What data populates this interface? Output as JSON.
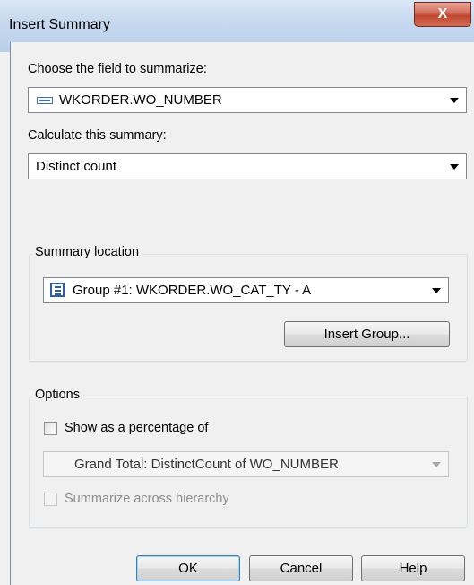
{
  "window": {
    "title": "Insert Summary",
    "close_label": "X"
  },
  "field": {
    "label": "Choose the field to summarize:",
    "value": "WKORDER.WO_NUMBER",
    "icon": "field-icon"
  },
  "summary": {
    "label": "Calculate this summary:",
    "value": "Distinct count"
  },
  "location": {
    "group_label": "Summary location",
    "value": "Group #1: WKORDER.WO_CAT_TY - A",
    "icon": "group-icon",
    "insert_group_label": "Insert Group..."
  },
  "options": {
    "group_label": "Options",
    "show_percentage_label": "Show as a percentage of",
    "show_percentage_checked": false,
    "percentage_value": "Grand Total: DistinctCount of WO_NUMBER",
    "summarize_hierarchy_label": "Summarize across hierarchy",
    "summarize_hierarchy_checked": false
  },
  "buttons": {
    "ok": "OK",
    "cancel": "Cancel",
    "help": "Help"
  }
}
